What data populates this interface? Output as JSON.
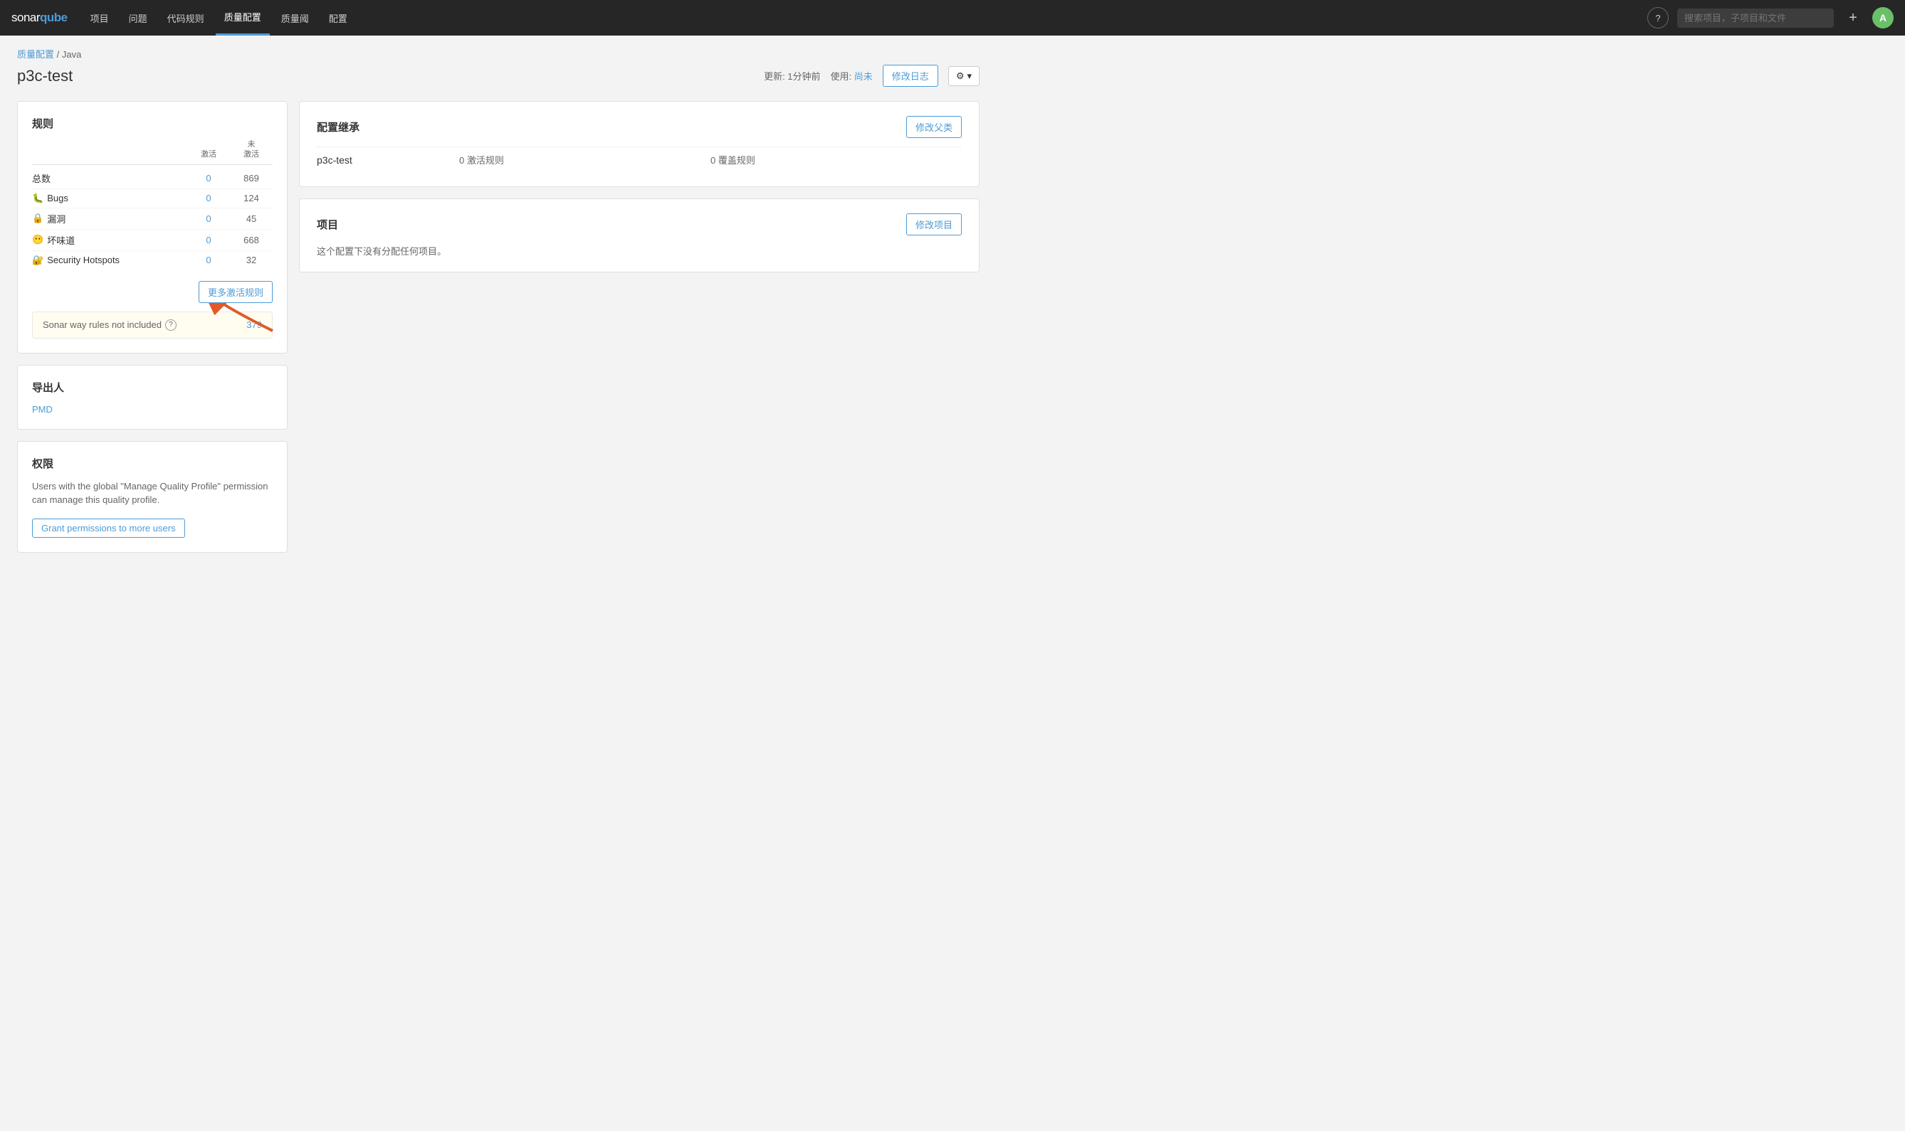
{
  "topnav": {
    "logo_sonar": "sonar",
    "logo_qube": "qube",
    "nav_items": [
      {
        "label": "项目",
        "active": false
      },
      {
        "label": "问题",
        "active": false
      },
      {
        "label": "代码规则",
        "active": false
      },
      {
        "label": "质量配置",
        "active": true
      },
      {
        "label": "质量阈",
        "active": false
      },
      {
        "label": "配置",
        "active": false
      }
    ],
    "search_placeholder": "搜索项目，子项目和文件",
    "plus_label": "+",
    "avatar_label": "A",
    "help_label": "?"
  },
  "breadcrumb": {
    "parent": "质量配置",
    "separator": " / ",
    "current": "Java"
  },
  "page": {
    "title": "p3c-test",
    "update_text": "更新: 1分钟前",
    "usage_prefix": "使用:",
    "usage_value": "尚未",
    "btn_log": "修改日志",
    "btn_gear": "⚙",
    "btn_gear_chevron": "▾"
  },
  "rules_card": {
    "title": "规则",
    "col_active": "激活",
    "col_active2": "",
    "col_inactive": "未激活",
    "col_inactive2": "",
    "rows": [
      {
        "label": "总数",
        "active": "0",
        "inactive": "869"
      },
      {
        "label": "Bugs",
        "active": "0",
        "inactive": "124",
        "icon": "🐛"
      },
      {
        "label": "漏洞",
        "active": "0",
        "inactive": "45",
        "icon": "🔒"
      },
      {
        "label": "坏味道",
        "active": "0",
        "inactive": "668",
        "icon": "😶"
      },
      {
        "label": "Security Hotspots",
        "active": "0",
        "inactive": "32",
        "icon": "🔐"
      }
    ],
    "btn_more_rules": "更多激活规则",
    "sonar_way_label": "Sonar way rules not included",
    "sonar_way_count": "379"
  },
  "exporter_card": {
    "title": "导出人",
    "exporter_name": "PMD"
  },
  "permissions_card": {
    "title": "权限",
    "desc": "Users with the global \"Manage Quality Profile\"\npermission can manage this quality profile.",
    "btn_grant": "Grant permissions to more users"
  },
  "inheritance_card": {
    "title": "配置继承",
    "btn_change_parent": "修改父类",
    "row": {
      "name": "p3c-test",
      "active_rules": "0 激活规则",
      "override_rules": "0 覆盖规则"
    }
  },
  "projects_card": {
    "title": "项目",
    "btn_change": "修改项目",
    "empty_text": "这个配置下没有分配任何项目。"
  }
}
